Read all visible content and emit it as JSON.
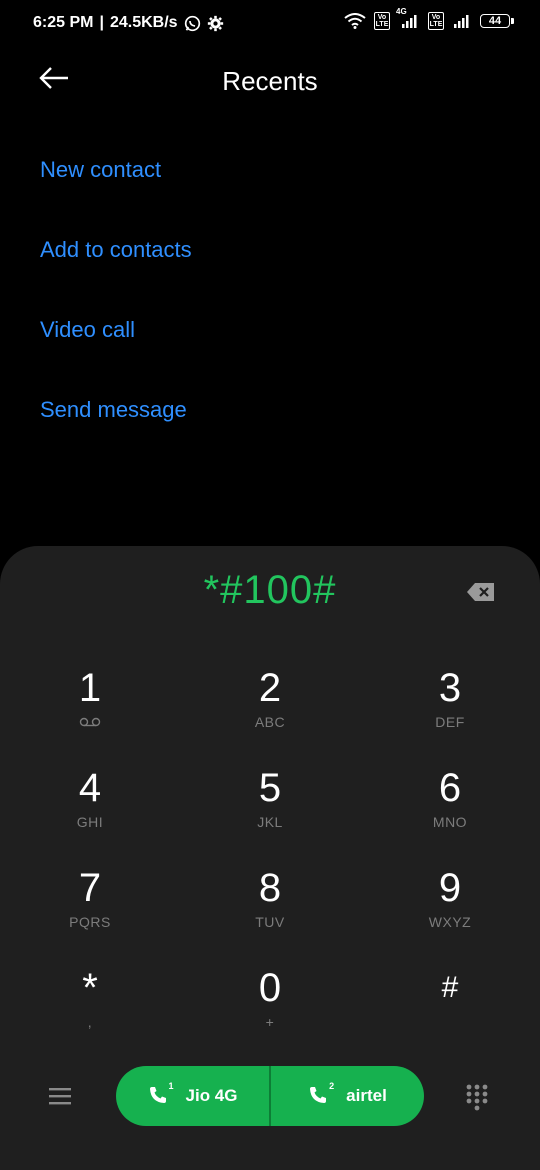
{
  "status_bar": {
    "time": "6:25 PM",
    "separator": "|",
    "net_speed": "24.5KB/s",
    "signal_label": "4G",
    "volte_label": "Vo LTE",
    "battery": "44",
    "icons": [
      "whatsapp-icon",
      "gear-icon",
      "wifi-icon",
      "volte-icon",
      "signal-icon",
      "battery-icon"
    ]
  },
  "header": {
    "title": "Recents"
  },
  "menu": {
    "items": [
      {
        "label": "New contact"
      },
      {
        "label": "Add to contacts"
      },
      {
        "label": "Video call"
      },
      {
        "label": "Send message"
      }
    ]
  },
  "dialer": {
    "number": "*#100#",
    "keys": [
      {
        "digit": "1",
        "letters": ""
      },
      {
        "digit": "2",
        "letters": "ABC"
      },
      {
        "digit": "3",
        "letters": "DEF"
      },
      {
        "digit": "4",
        "letters": "GHI"
      },
      {
        "digit": "5",
        "letters": "JKL"
      },
      {
        "digit": "6",
        "letters": "MNO"
      },
      {
        "digit": "7",
        "letters": "PQRS"
      },
      {
        "digit": "8",
        "letters": "TUV"
      },
      {
        "digit": "9",
        "letters": "WXYZ"
      },
      {
        "digit": "*",
        "letters": ","
      },
      {
        "digit": "0",
        "letters": "+"
      },
      {
        "digit": "#",
        "letters": ""
      }
    ],
    "sim1": {
      "label": "Jio 4G",
      "slot": "1"
    },
    "sim2": {
      "label": "airtel",
      "slot": "2"
    }
  },
  "colors": {
    "accent_link": "#2f8fff",
    "dial_number": "#22c55e",
    "call_button": "#16b14f",
    "dialer_bg": "#1f1f1f"
  }
}
